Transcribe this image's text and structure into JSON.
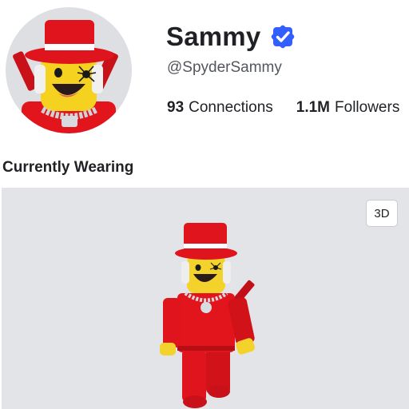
{
  "profile": {
    "display_name": "Sammy",
    "username": "@SpyderSammy",
    "verified_icon": "verified-check-badge",
    "stats": [
      {
        "value": "93",
        "label": "Connections"
      },
      {
        "value": "1.1M",
        "label": "Followers"
      }
    ]
  },
  "wearing": {
    "title": "Currently Wearing",
    "toggle_3d_label": "3D"
  },
  "colors": {
    "accent": "#335fff",
    "hat_red": "#d8121a",
    "skin_yellow": "#f3d22b",
    "viewer_bg": "#e3e4e7"
  }
}
